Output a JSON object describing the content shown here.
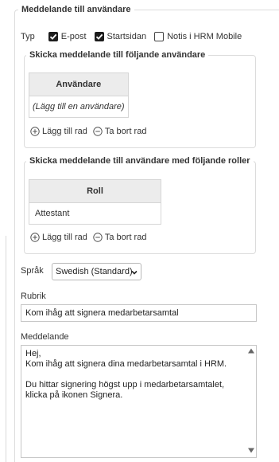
{
  "section": {
    "title": "Meddelande till användare"
  },
  "type_row": {
    "label": "Typ",
    "options": [
      {
        "label": "E-post",
        "checked": true
      },
      {
        "label": "Startsidan",
        "checked": true
      },
      {
        "label": "Notis i HRM Mobile",
        "checked": false
      }
    ]
  },
  "users_group": {
    "title": "Skicka meddelande till följande användare",
    "column": "Användare",
    "rows": [
      "(Lägg till en användare)"
    ],
    "add_row": "Lägg till rad",
    "remove_row": "Ta bort rad"
  },
  "roles_group": {
    "title": "Skicka meddelande till användare med följande roller",
    "column": "Roll",
    "rows": [
      "Attestant"
    ],
    "add_row": "Lägg till rad",
    "remove_row": "Ta bort rad"
  },
  "language": {
    "label": "Språk",
    "value": "Swedish (Standard)"
  },
  "subject": {
    "label": "Rubrik",
    "value": "Kom ihåg att signera medarbetarsamtal"
  },
  "message": {
    "label": "Meddelande",
    "value": "Hej,\nKom ihåg att signera dina medarbetarsamtal i HRM.\n\nDu hittar signering högst upp i medarbetarsamtalet, klicka på ikonen Signera."
  },
  "colors": {
    "accent": "#2e6fb7",
    "checkbox_checked": "#1c1c1c",
    "header_bg": "#ececec"
  }
}
